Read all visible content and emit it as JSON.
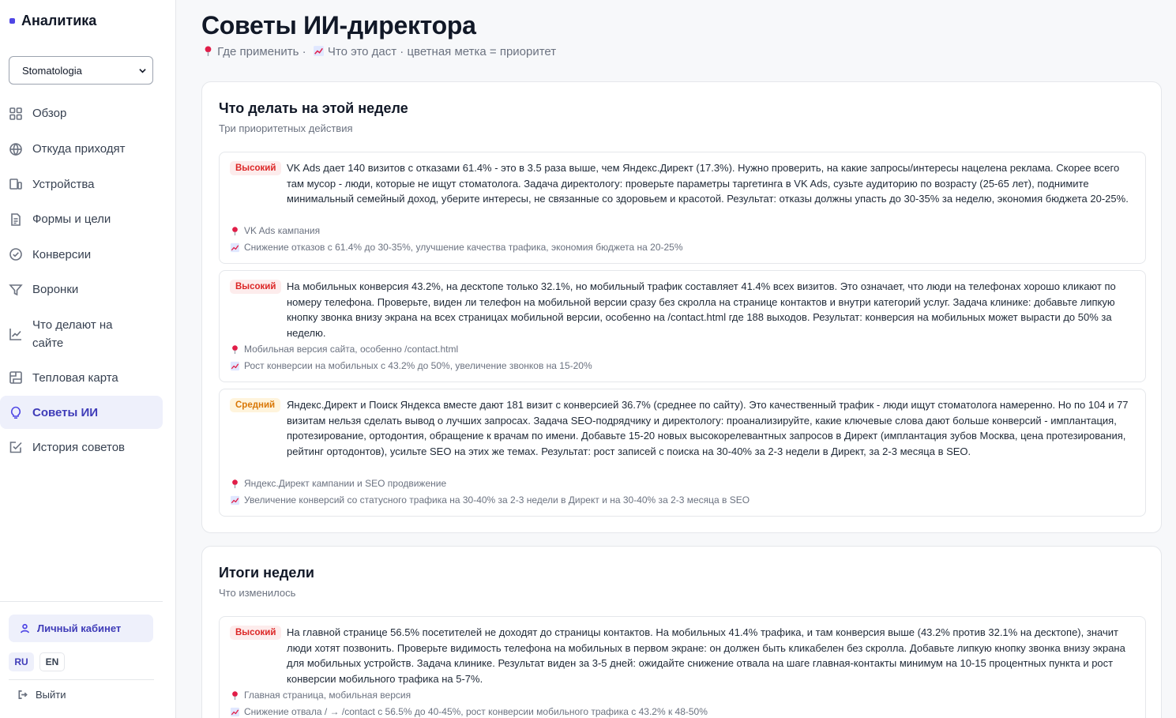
{
  "app": {
    "title": "Аналитика",
    "brand_color": "#4f46e5"
  },
  "sidebar": {
    "project_select": {
      "value": "Stomatologia"
    },
    "items": [
      {
        "label": "Обзор",
        "icon": "grid-icon"
      },
      {
        "label": "Откуда приходят",
        "icon": "globe-icon"
      },
      {
        "label": "Устройства",
        "icon": "devices-icon"
      },
      {
        "label": "Формы и цели",
        "icon": "document-icon"
      },
      {
        "label": "Конверсии",
        "icon": "check-circle-icon"
      },
      {
        "label": "Воронки",
        "icon": "funnel-icon"
      },
      {
        "label": "Что делают на сайте",
        "icon": "activity-chart-icon"
      },
      {
        "label": "Тепловая карта",
        "icon": "heatmap-icon"
      },
      {
        "label": "Советы ИИ",
        "icon": "lightbulb-icon",
        "active": true
      },
      {
        "label": "История советов",
        "icon": "history-check-icon"
      }
    ],
    "cabinet_label": "Личный кабинет",
    "lang": {
      "ru": "RU",
      "en": "EN",
      "active": "RU"
    },
    "logout_label": "Выйти"
  },
  "main": {
    "title": "Советы ИИ-директора",
    "subtitle": "Где применить · Что это даст · цветная метка = приоритет",
    "subtitle_where": "Где применить ·",
    "subtitle_what": "Что это даст · цветная метка = приоритет",
    "week": {
      "title": "Что делать на этой неделе",
      "subtitle": "Три приоритетных действия",
      "items": [
        {
          "priority": "Высокий",
          "level": "high",
          "text": "VK Ads дает 140 визитов с отказами 61.4% - это в 3.5 раза выше, чем Яндекс.Директ (17.3%). Нужно проверить, на какие запросы/интересы нацелена реклама. Скорее всего там мусор - люди, которые не ищут стоматолога. Задача директологу: проверьте параметры таргетинга в VK Ads, сузьте аудиторию по возрасту (25-65 лет), поднимите минимальный семейный доход, уберите интересы, не связанные со здоровьем и красотой. Результат: отказы должны упасть до 30-35% за неделю, экономия бюджета 20-25%.",
          "where": "VK Ads кампания",
          "effect": "Снижение отказов с 61.4% до 30-35%, улучшение качества трафика, экономия бюджета на 20-25%"
        },
        {
          "priority": "Высокий",
          "level": "high",
          "text": "На мобильных конверсия 43.2%, на десктопе только 32.1%, но мобильный трафик составляет 41.4% всех визитов. Это означает, что люди на телефонах хорошо кликают по номеру телефона. Проверьте, виден ли телефон на мобильной версии сразу без скролла на странице контактов и внутри категорий услуг. Задача клинике: добавьте липкую кнопку звонка внизу экрана на всех страницах мобильной версии, особенно на /contact.html где 188 выходов. Результат: конверсия на мобильных может вырасти до 50% за неделю.",
          "where": "Мобильная версия сайта, особенно /contact.html",
          "effect": "Рост конверсии на мобильных с 43.2% до 50%, увеличение звонков на 15-20%"
        },
        {
          "priority": "Средний",
          "level": "mid",
          "text": "Яндекс.Директ и Поиск Яндекса вместе дают 181 визит с конверсией 36.7% (среднее по сайту). Это качественный трафик - люди ищут стоматолога намеренно. Но по 104 и 77 визитам нельзя сделать вывод о лучших запросах. Задача SEO-подрядчику и директологу: проанализируйте, какие ключевые слова дают больше конверсий - имплантация, протезирование, ортодонтия, обращение к врачам по имени. Добавьте 15-20 новых высокорелевантных запросов в Директ (имплантация зубов Москва, цена протезирования, рейтинг ортодонтов), усильте SEO на этих же темах. Результат: рост записей с поиска на 30-40% за 2-3 недели в Директ, за 2-3 месяца в SEO.",
          "where": "Яндекс.Директ кампании и SEO продвижение",
          "effect": "Увеличение конверсий со статусного трафика на 30-40% за 2-3 недели в Директ и на 30-40% за 2-3 месяца в SEO"
        }
      ]
    },
    "summary": {
      "title": "Итоги недели",
      "subtitle": "Что изменилось",
      "items": [
        {
          "priority": "Высокий",
          "level": "high",
          "text": "На главной странице 56.5% посетителей не доходят до страницы контактов. На мобильных 41.4% трафика, и там конверсия выше (43.2% против 32.1% на десктопе), значит люди хотят позвонить. Проверьте видимость телефона на мобильных в первом экране: он должен быть кликабелен без скролла. Добавьте липкую кнопку звонка внизу экрана для мобильных устройств. Задача клинике. Результат виден за 3-5 дней: ожидайте снижение отвала на шаге главная-контакты минимум на 10-15 процентных пункта и рост конверсии мобильного трафика на 5-7%.",
          "where": "Главная страница, мобильная версия",
          "effect": "Снижение отвала / → /contact с 56.5% до 40-45%, рост конверсии мобильного трафика с 43.2% к 48-50%"
        }
      ]
    }
  }
}
